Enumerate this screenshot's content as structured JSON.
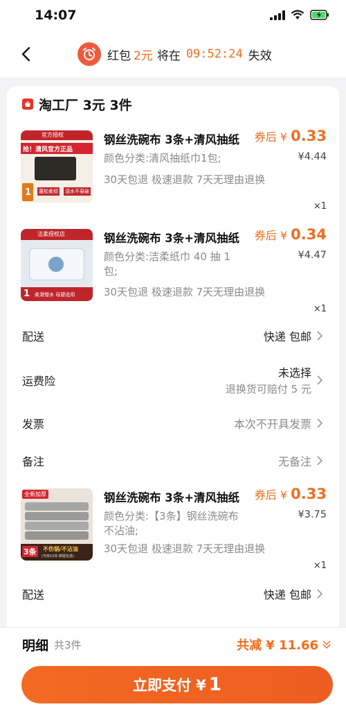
{
  "status_bar": {
    "time": "14:07"
  },
  "header": {
    "prefix": "红包",
    "amount": "2元",
    "middle": "将在",
    "countdown": "09:52:24",
    "suffix": "失效"
  },
  "shop": {
    "name": "淘工厂 3元 3件"
  },
  "items": [
    {
      "title": "钢丝洗碗布 3条+清风抽纸",
      "price_label": "券后",
      "price_currency": "¥",
      "price": "0.33",
      "sku": "颜色分类:清风抽纸巾1包;",
      "orig_price": "¥4.44",
      "services": "30天包退   极速退款   7天无理由退换",
      "qty": "×1",
      "thumb": {
        "tag": "官方授权",
        "banner": "抢！清风官方正品",
        "count": "1",
        "footer1": "蓬松柔韧",
        "footer2": "湿水不易破"
      }
    },
    {
      "title": "钢丝洗碗布 3条+清风抽纸",
      "price_label": "券后",
      "price_currency": "¥",
      "price": "0.34",
      "sku": "颜色分类:洁柔纸巾 40 抽 1 包;",
      "orig_price": "¥4.47",
      "services": "30天包退   极速退款   7天无理由退换",
      "qty": "×1",
      "thumb": {
        "tag": "洁柔授权店",
        "count": "1",
        "footer1": "柔滑憎水 母婴适用"
      }
    },
    {
      "title": "钢丝洗碗布 3条+清风抽纸",
      "price_label": "券后",
      "price_currency": "¥",
      "price": "0.33",
      "sku": "颜色分类:【3条】钢丝洗碗布不沾油;",
      "orig_price": "¥3.75",
      "services": "30天包退   极速退款   7天无理由退换",
      "qty": "×1",
      "thumb": {
        "tag": "全新加厚",
        "count": "3条",
        "footer1": "不伤锅/不沾油",
        "footer2": "(可用10年·擦碰包退)"
      }
    }
  ],
  "rows": {
    "delivery_label": "配送",
    "delivery_value": "快递 包邮",
    "insurance_label": "运费险",
    "insurance_value": "未选择",
    "insurance_sub": "退换货可赔付 5 元",
    "invoice_label": "发票",
    "invoice_value": "本次不开具发票",
    "note_label": "备注",
    "note_value": "无备注",
    "delivery2_label": "配送",
    "delivery2_value": "快递 包邮"
  },
  "bottom": {
    "detail_label": "明细",
    "detail_count": "共3件",
    "saving": "共减 ¥ 11.66",
    "pay_label": "立即支付 ¥",
    "pay_amount": "1"
  },
  "colors": {
    "accent": "#f06d1f",
    "pay_button": "#f26a22",
    "shop_icon": "#e8332a"
  }
}
